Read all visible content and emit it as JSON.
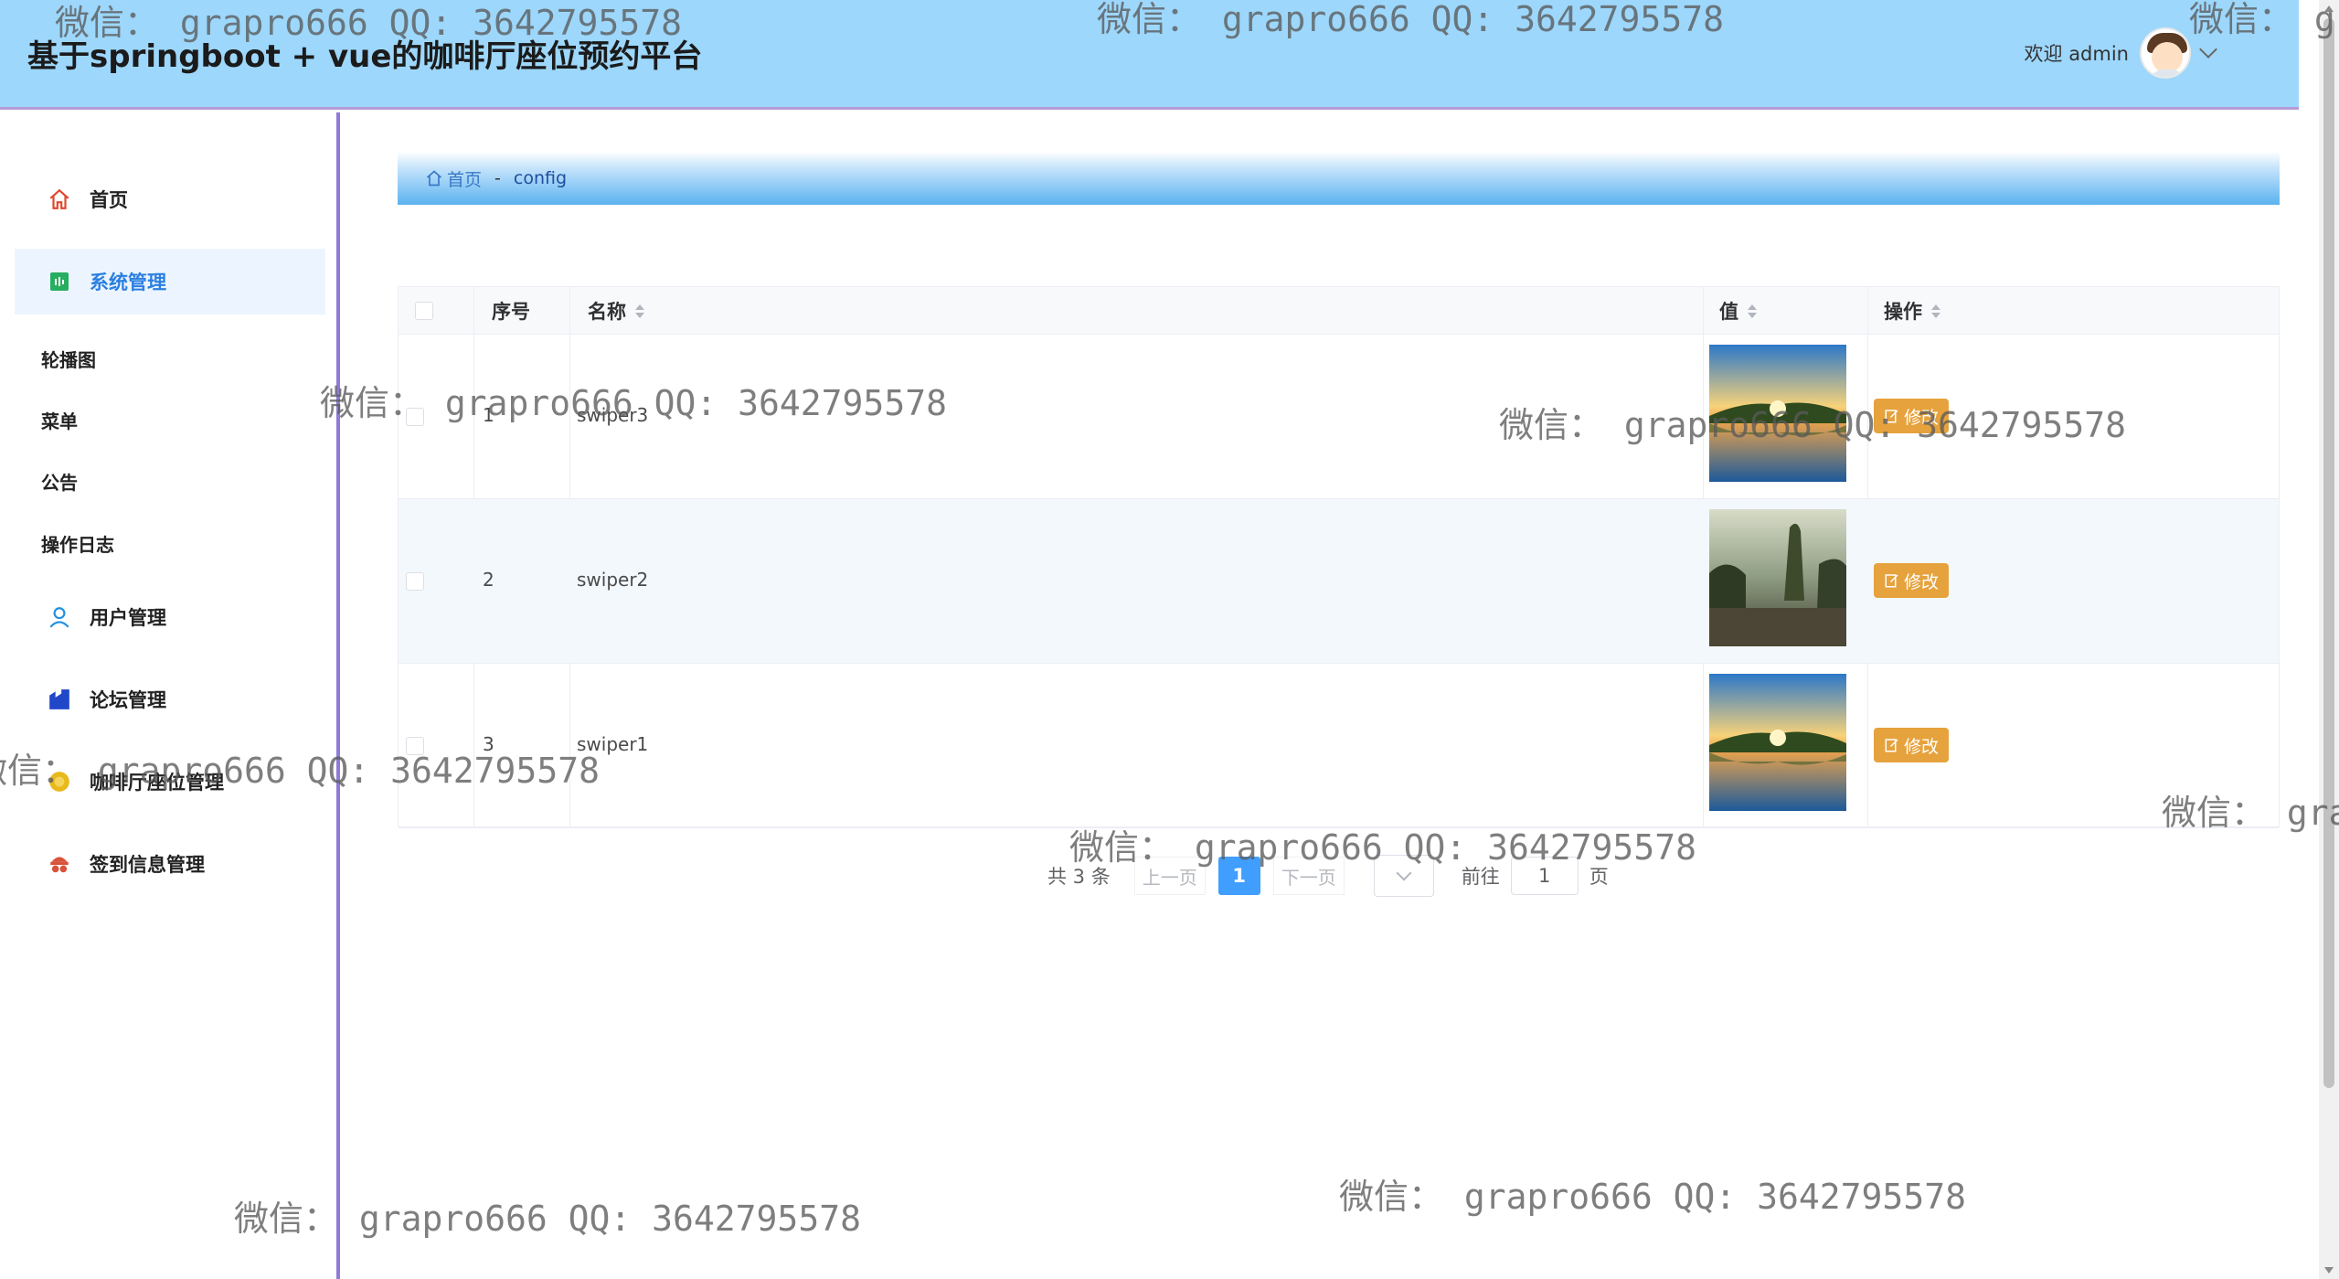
{
  "header": {
    "title": "基于springboot + vue的咖啡厅座位预约平台",
    "welcome": "欢迎 admin"
  },
  "sidebar": {
    "items": [
      {
        "label": "首页",
        "icon": "home-icon"
      },
      {
        "label": "系统管理",
        "icon": "system-icon",
        "active": true
      },
      {
        "label": "用户管理",
        "icon": "user-icon"
      },
      {
        "label": "论坛管理",
        "icon": "forum-icon"
      },
      {
        "label": "咖啡厅座位管理",
        "icon": "coffee-seat-icon"
      },
      {
        "label": "签到信息管理",
        "icon": "checkin-icon"
      }
    ],
    "sub_items": [
      "轮播图",
      "菜单",
      "公告",
      "操作日志"
    ]
  },
  "breadcrumb": {
    "home": "首页",
    "separator": "-",
    "current": "config"
  },
  "table": {
    "headers": [
      "序号",
      "名称",
      "值",
      "操作"
    ],
    "rows": [
      {
        "index": "1",
        "name": "swiper3",
        "action": "修改"
      },
      {
        "index": "2",
        "name": "swiper2",
        "action": "修改"
      },
      {
        "index": "3",
        "name": "swiper1",
        "action": "修改"
      }
    ]
  },
  "pagination": {
    "total": "共 3 条",
    "prev": "上一页",
    "page": "1",
    "next": "下一页",
    "goto": "前往",
    "goto_value": "1",
    "page_unit": "页"
  },
  "watermark": "微信： grapro666 QQ: 3642795578",
  "colors": {
    "header_bg": "#9dd7fb",
    "active_menu": "#2b7fe0",
    "edit_button": "#e6a23c",
    "page_active": "#409eff"
  }
}
